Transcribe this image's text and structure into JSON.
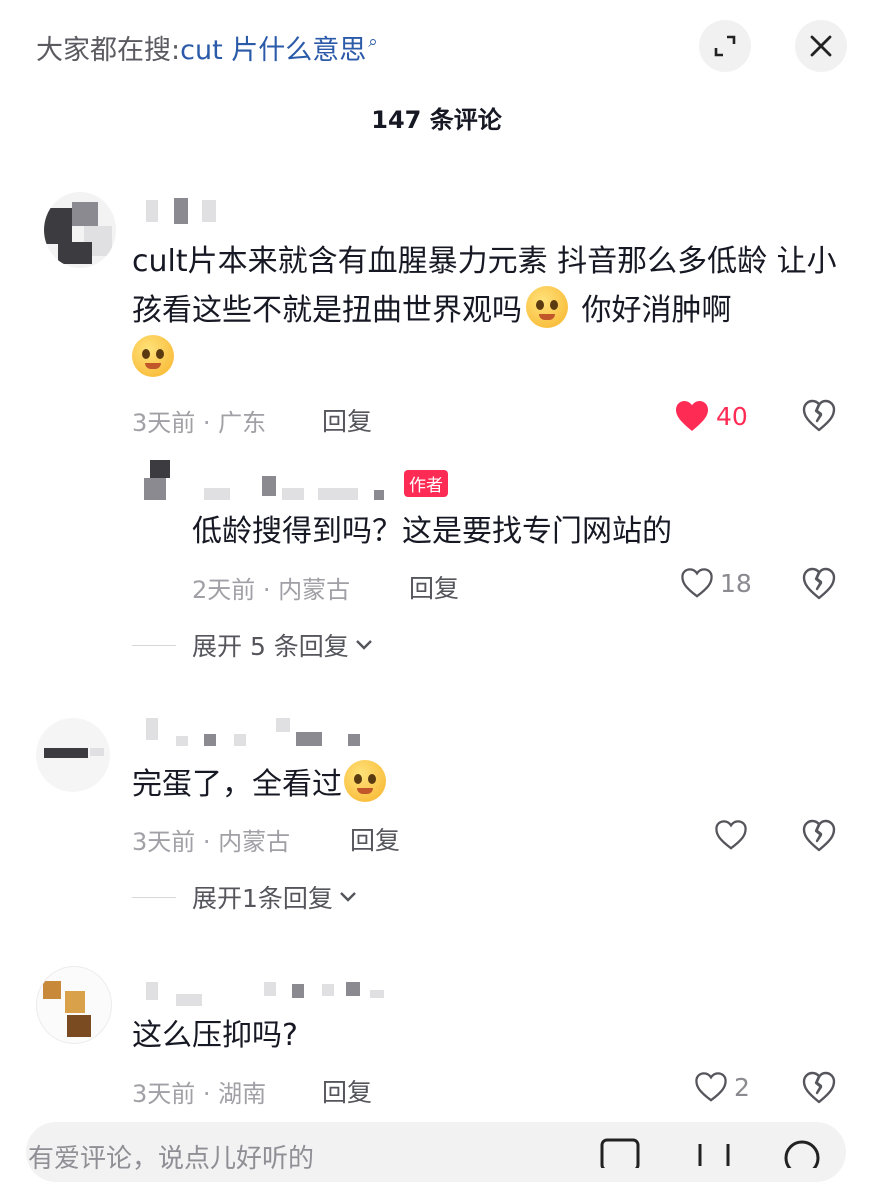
{
  "header": {
    "search_prefix": "大家都在搜:",
    "search_term": "cut 片什么意思",
    "comment_count": "147 条评论"
  },
  "comments": [
    {
      "text_part1": "cult片本来就含有血腥暴力元素 抖音那么多低龄 让小孩看这些不就是扭曲世界观吗",
      "text_part2": " 你好消肿啊",
      "meta": "3天前 · 广东",
      "reply_label": "回复",
      "likes": "40",
      "liked": true,
      "reply": {
        "badge": "作者",
        "text": "低龄搜得到吗？这是要找专门网站的",
        "meta": "2天前 · 内蒙古",
        "reply_label": "回复",
        "likes": "18"
      },
      "expand_label": "展开 5 条回复"
    },
    {
      "text": "完蛋了，全看过",
      "meta": "3天前 · 内蒙古",
      "reply_label": "回复",
      "expand_label": "展开1条回复"
    },
    {
      "text": "这么压抑吗?",
      "meta": "3天前 · 湖南",
      "reply_label": "回复",
      "likes": "2"
    }
  ],
  "composer": {
    "placeholder": "有爱评论，说点儿好听的"
  },
  "colors": {
    "accent": "#fe2c55",
    "link": "#2a5aa8",
    "text": "#161823",
    "muted": "#a0a0a6"
  }
}
